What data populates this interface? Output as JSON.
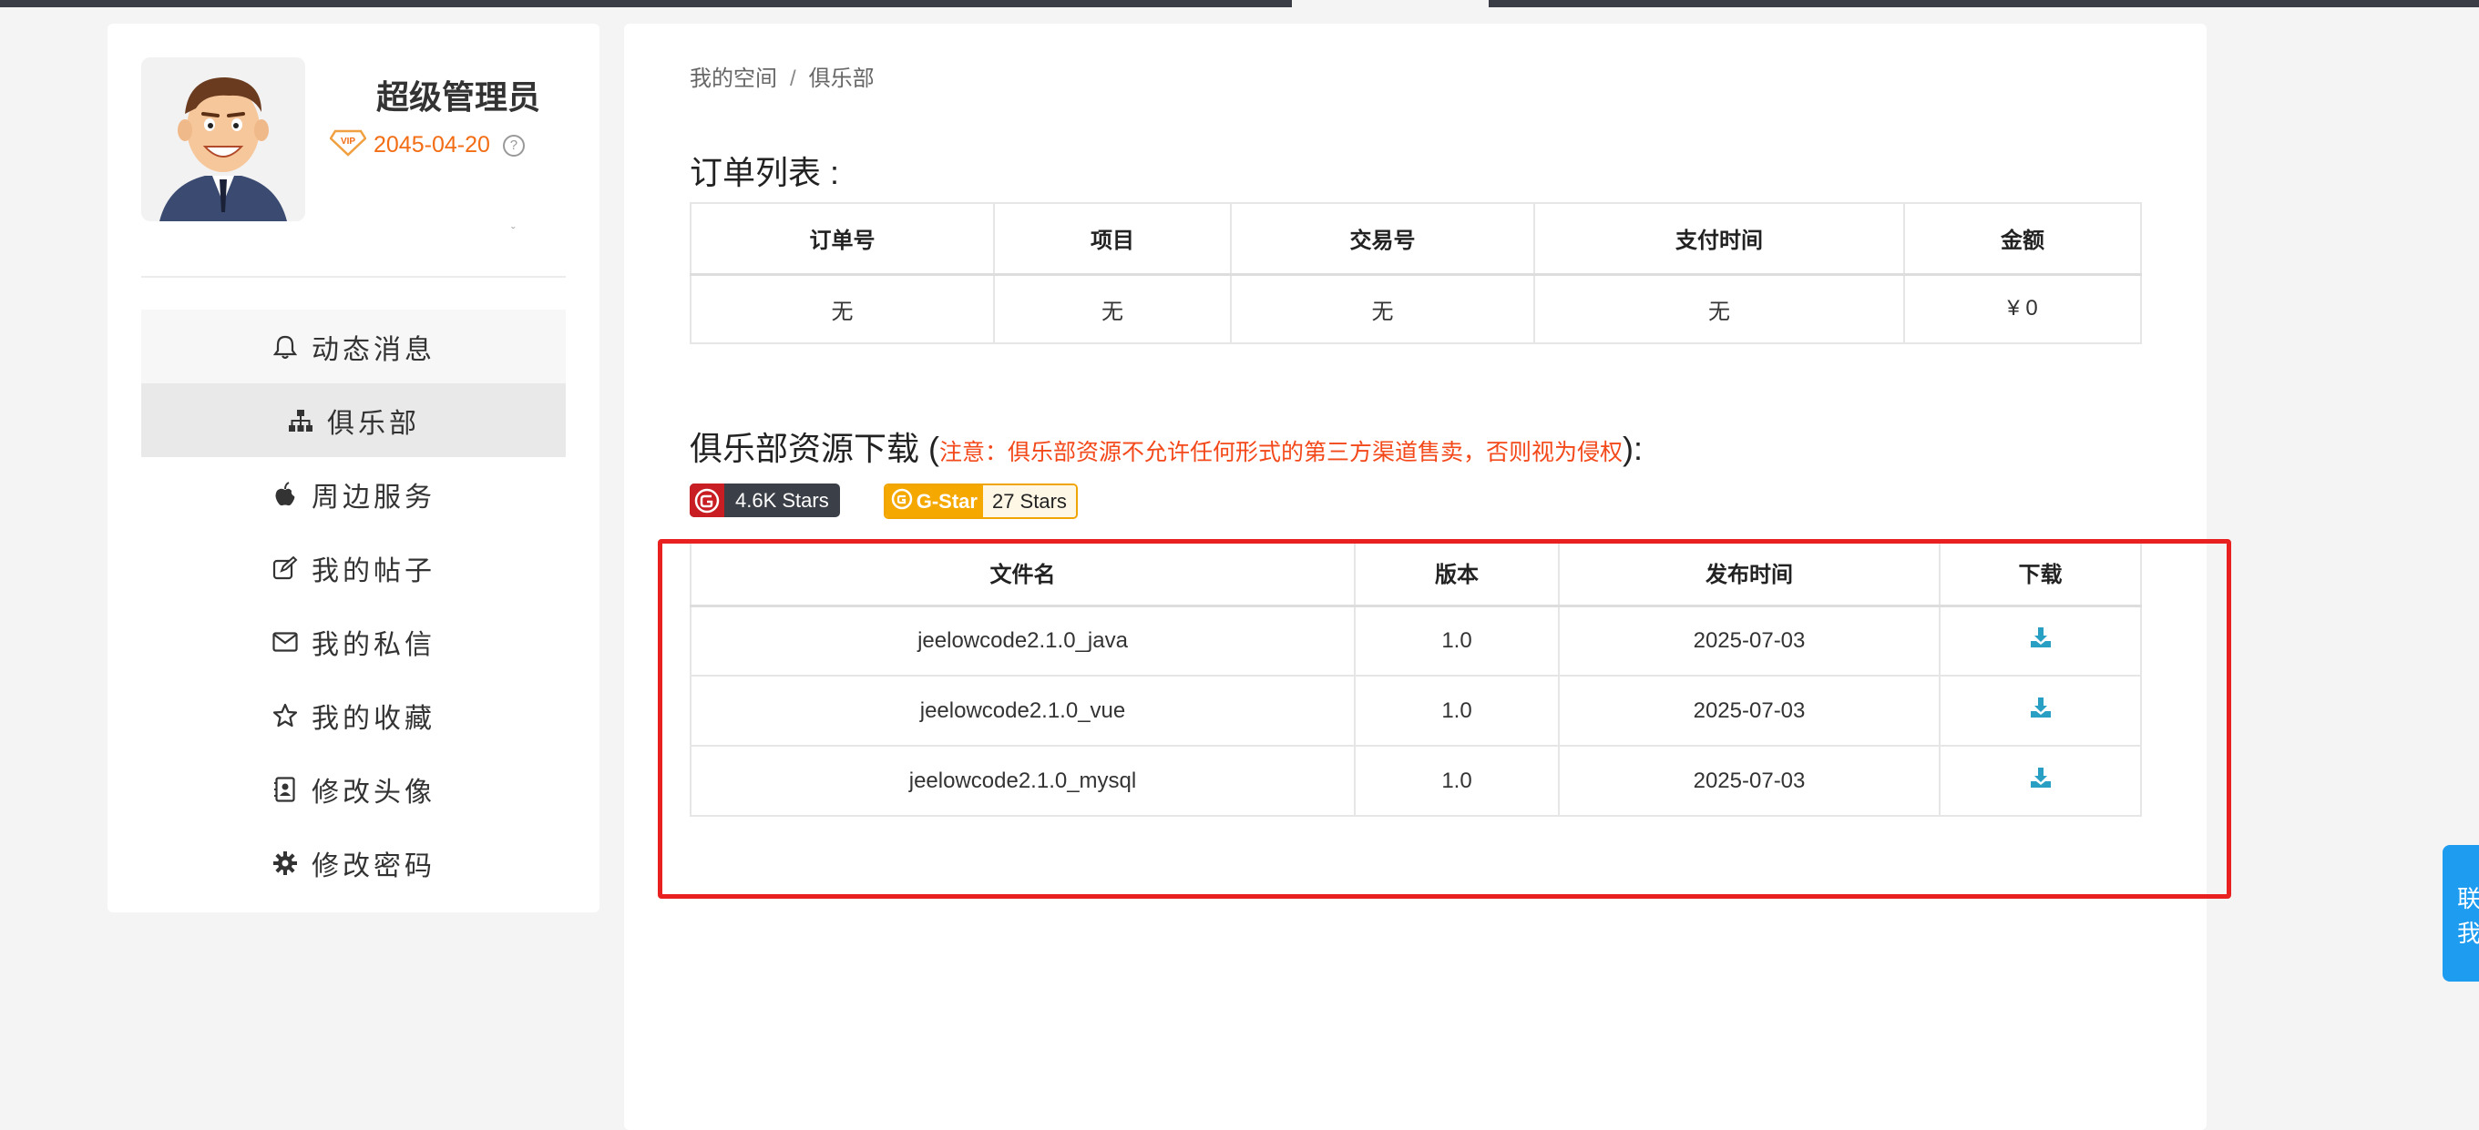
{
  "colors": {
    "accent": "#f26d14",
    "notice": "#f3481a",
    "download": "#2a9fc4",
    "contact": "#1e9cf0",
    "highlight_border": "#e8201f"
  },
  "profile": {
    "name": "超级管理员",
    "vip_badge": "VIP",
    "vip_date": "2045-04-20",
    "help_icon": "?"
  },
  "sidebar": {
    "items": [
      {
        "label": "动态消息",
        "icon": "bell-icon"
      },
      {
        "label": "俱乐部",
        "icon": "sitemap-icon",
        "active": true
      },
      {
        "label": "周边服务",
        "icon": "apple-icon"
      },
      {
        "label": "我的帖子",
        "icon": "edit-icon"
      },
      {
        "label": "我的私信",
        "icon": "envelope-icon"
      },
      {
        "label": "我的收藏",
        "icon": "star-icon"
      },
      {
        "label": "修改头像",
        "icon": "contact-card-icon"
      },
      {
        "label": "修改密码",
        "icon": "gear-icon"
      }
    ]
  },
  "breadcrumb": {
    "home": "我的空间",
    "separator": "/",
    "current": "俱乐部"
  },
  "orders": {
    "title": "订单列表 :",
    "headers": [
      "订单号",
      "项目",
      "交易号",
      "支付时间",
      "金额"
    ],
    "rows": [
      [
        "无",
        "无",
        "无",
        "无",
        "¥ 0"
      ]
    ]
  },
  "downloads": {
    "title": "俱乐部资源下载",
    "open_paren": "(",
    "notice": "注意：俱乐部资源不允许任何形式的第三方渠道售卖，否则视为侵权",
    "close_paren": "):",
    "badges": {
      "gitee_text": "4.6K Stars",
      "gstar_left": "G-Star",
      "gstar_right": "27 Stars"
    },
    "headers": [
      "文件名",
      "版本",
      "发布时间",
      "下载"
    ],
    "rows": [
      [
        "jeelowcode2.1.0_java",
        "1.0",
        "2025-07-03"
      ],
      [
        "jeelowcode2.1.0_vue",
        "1.0",
        "2025-07-03"
      ],
      [
        "jeelowcode2.1.0_mysql",
        "1.0",
        "2025-07-03"
      ]
    ]
  },
  "contact": {
    "label": "联\n我"
  }
}
